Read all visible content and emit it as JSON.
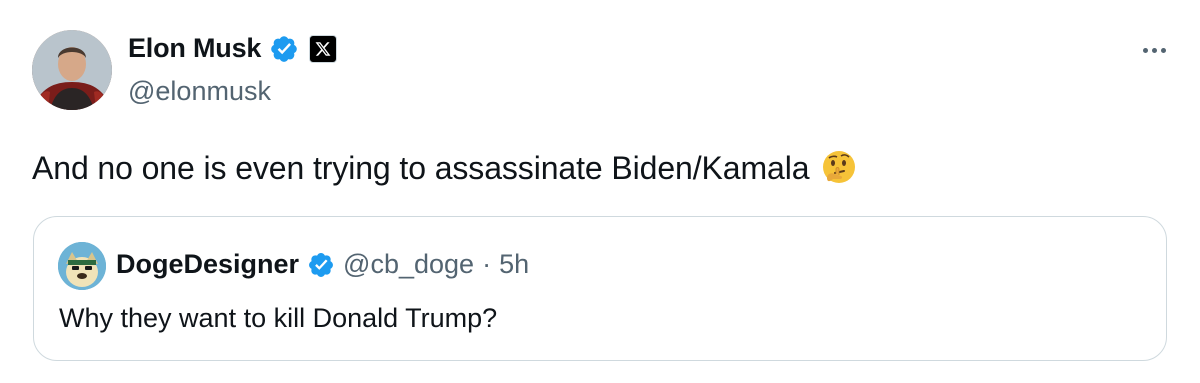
{
  "author": {
    "display_name": "Elon Musk",
    "handle": "@elonmusk",
    "verified_icon": "verified-badge-icon",
    "affiliation_icon": "x-logo-icon",
    "avatar": "author-avatar"
  },
  "menu": {
    "icon": "more-options-icon"
  },
  "tweet": {
    "text": "And no one is even trying to assassinate Biden/Kamala",
    "emoji": "thinking-face-emoji"
  },
  "quoted": {
    "display_name": "DogeDesigner",
    "handle": "@cb_doge",
    "separator": "·",
    "time": "5h",
    "text": "Why they want to kill Donald Trump?",
    "verified_icon": "verified-badge-icon",
    "avatar": "quoted-author-avatar"
  },
  "colors": {
    "text_primary": "#0f1419",
    "text_secondary": "#536471",
    "verified_blue": "#1d9bf0",
    "border": "#cfd9de"
  }
}
